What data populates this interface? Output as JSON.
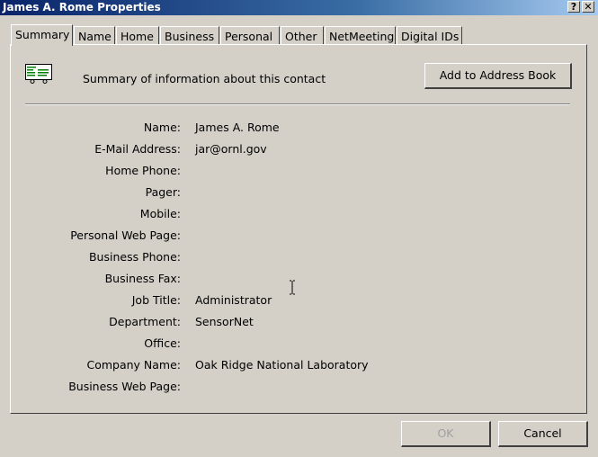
{
  "window": {
    "title": "James A. Rome Properties",
    "help_button": "?",
    "close_button": "✕"
  },
  "tabs": [
    {
      "label": "Summary",
      "active": true
    },
    {
      "label": "Name"
    },
    {
      "label": "Home"
    },
    {
      "label": "Business"
    },
    {
      "label": "Personal"
    },
    {
      "label": "Other"
    },
    {
      "label": "NetMeeting"
    },
    {
      "label": "Digital IDs"
    }
  ],
  "summary": {
    "description": "Summary of information about this contact",
    "add_button": "Add to Address Book"
  },
  "fields": [
    {
      "label": "Name:",
      "value": "James A. Rome"
    },
    {
      "label": "E-Mail Address:",
      "value": "jar@ornl.gov"
    },
    {
      "label": "Home Phone:",
      "value": ""
    },
    {
      "label": "Pager:",
      "value": ""
    },
    {
      "label": "Mobile:",
      "value": ""
    },
    {
      "label": "Personal Web Page:",
      "value": ""
    },
    {
      "label": "Business Phone:",
      "value": ""
    },
    {
      "label": "Business Fax:",
      "value": ""
    },
    {
      "label": "Job Title:",
      "value": "Administrator"
    },
    {
      "label": "Department:",
      "value": "SensorNet"
    },
    {
      "label": "Office:",
      "value": ""
    },
    {
      "label": "Company Name:",
      "value": "Oak Ridge National Laboratory"
    },
    {
      "label": "Business Web Page:",
      "value": ""
    }
  ],
  "footer": {
    "ok": "OK",
    "cancel": "Cancel"
  }
}
